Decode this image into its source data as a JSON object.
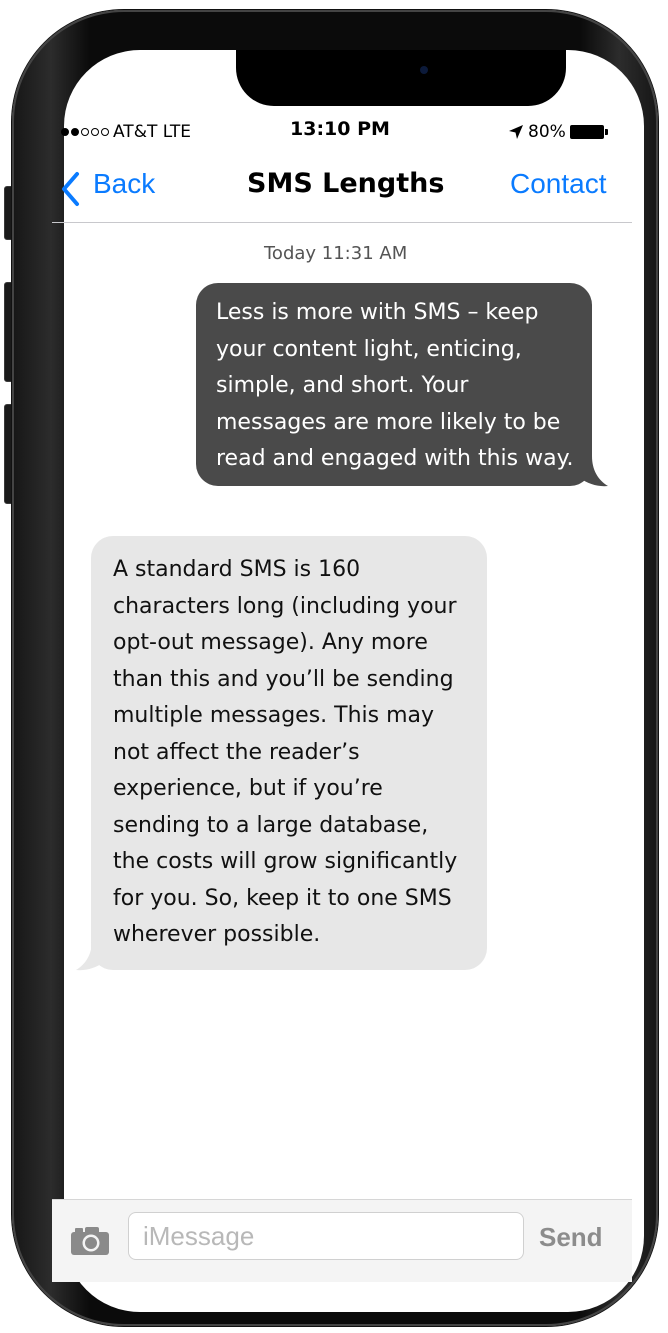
{
  "status_bar": {
    "signal_dots_filled": 2,
    "signal_dots_total": 5,
    "carrier": "AT&T LTE",
    "time": "13:10 PM",
    "battery": "80%",
    "location_icon": "location-arrow-icon"
  },
  "nav": {
    "back_label": "Back",
    "title": "SMS Lengths",
    "contact_label": "Contact"
  },
  "conversation": {
    "timestamp": "Today 11:31 AM",
    "messages": [
      {
        "direction": "outgoing",
        "lines": [
          "Less is more with SMS – keep",
          "your content light, enticing,",
          "simple, and short. Your",
          "messages are more likely to be",
          "read and engaged with this way."
        ]
      },
      {
        "direction": "incoming",
        "lines": [
          "A standard SMS is 160",
          "characters long (including your",
          "opt-out message). Any more",
          "than this and you’ll be sending",
          "multiple messages. This may",
          "not affect the reader’s",
          "experience, but if you’re",
          "sending to a large database,",
          "the costs will grow significantly",
          "for you. So, keep it to one SMS",
          "wherever possible."
        ]
      }
    ]
  },
  "composer": {
    "camera_icon": "camera-icon",
    "placeholder": "iMessage",
    "send_label": "Send"
  },
  "colors": {
    "accent": "#0a7bff",
    "outgoing_bubble": "#4a4a4a",
    "incoming_bubble": "#e7e7e7"
  }
}
